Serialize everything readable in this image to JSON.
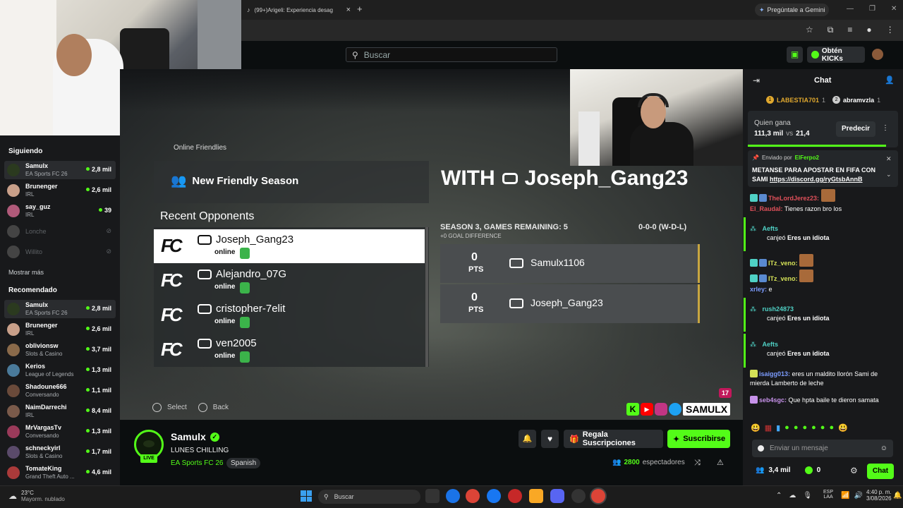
{
  "browser": {
    "tab_title": "(99+)Arigeli: Experiencia desag",
    "tab_close": "×",
    "new_tab": "+",
    "gemini": "Pregúntale a Gemini"
  },
  "header": {
    "search_placeholder": "Buscar",
    "kicks": "Obtén KICKs"
  },
  "sidebar": {
    "following_title": "Siguiendo",
    "following": [
      {
        "name": "Samulx",
        "cat": "EA Sports FC 26",
        "viewers": "2,8 mil",
        "color": "#2b3a1f"
      },
      {
        "name": "Brunenger",
        "cat": "IRL",
        "viewers": "2,6 mil",
        "color": "#c9a08a"
      },
      {
        "name": "say_guz",
        "cat": "IRL",
        "viewers": "39",
        "color": "#b05a7a"
      },
      {
        "name": "Lonche",
        "cat": "",
        "viewers": "",
        "color": "#444"
      },
      {
        "name": "Willito",
        "cat": "",
        "viewers": "",
        "color": "#444"
      }
    ],
    "show_more": "Mostrar más",
    "recommended_title": "Recomendado",
    "recommended": [
      {
        "name": "Samulx",
        "cat": "EA Sports FC 26",
        "viewers": "2,8 mil",
        "color": "#2b3a1f"
      },
      {
        "name": "Brunenger",
        "cat": "IRL",
        "viewers": "2,6 mil",
        "color": "#c9a08a"
      },
      {
        "name": "oblivionsw",
        "cat": "Slots & Casino",
        "viewers": "3,7 mil",
        "color": "#8a6a4a"
      },
      {
        "name": "Kerios",
        "cat": "League of Legends",
        "viewers": "1,3 mil",
        "color": "#4a7a9a"
      },
      {
        "name": "Shadoune666",
        "cat": "Conversando",
        "viewers": "1,1 mil",
        "color": "#6a4a3a"
      },
      {
        "name": "NaimDarrechi",
        "cat": "IRL",
        "viewers": "8,4 mil",
        "color": "#7a5a4a"
      },
      {
        "name": "MrVargasTv",
        "cat": "Conversando",
        "viewers": "1,3 mil",
        "color": "#9a3a5a"
      },
      {
        "name": "schneckyirl",
        "cat": "Slots & Casino",
        "viewers": "1,7 mil",
        "color": "#5a4a6a"
      },
      {
        "name": "TomateKing",
        "cat": "Grand Theft Auto ...",
        "viewers": "4,6 mil",
        "color": "#aa3a3a"
      }
    ]
  },
  "game": {
    "breadcrumb": "Online Friendlies",
    "new_season": "New Friendly Season",
    "recent_title": "Recent Opponents",
    "opponents": [
      {
        "name": "Joseph_Gang23",
        "status": "online"
      },
      {
        "name": "Alejandro_07G",
        "status": "online"
      },
      {
        "name": "cristopher-7elit",
        "status": "online"
      },
      {
        "name": "ven2005",
        "status": "online"
      }
    ],
    "with_title": "WITH",
    "with_name": "Joseph_Gang23",
    "season_info": "SEASON 3, GAMES REMAINING: 5",
    "goal_diff": "+0 GOAL DIFFERENCE",
    "record": "0-0-0 (W-D-L)",
    "scores": [
      {
        "pts": "0",
        "label": "PTS",
        "player": "Samulx1106"
      },
      {
        "pts": "0",
        "label": "PTS",
        "player": "Joseph_Gang23"
      }
    ],
    "select": "Select",
    "back": "Back",
    "overlay_name": "SAMULX",
    "counter": "17"
  },
  "stream": {
    "name": "Samulx",
    "title": "LUNES CHILLING",
    "category": "EA Sports FC 26",
    "language": "Spanish",
    "live": "LIVE",
    "gift": "Regala Suscripciones",
    "subscribe": "Suscribirse",
    "viewers": "2800",
    "viewers_label": "espectadores"
  },
  "chat": {
    "title": "Chat",
    "top1": "LABESTIA701",
    "top1_n": "1",
    "top2": "abramvzla",
    "top2_n": "1",
    "prediction_q": "Quien gana",
    "pred_a": "111,3 mil",
    "pred_vs": "vs",
    "pred_b": "21,4",
    "predict_btn": "Predecir",
    "pinned_by": "Enviado por",
    "pinned_user": "ElFerpo2",
    "pinned_text": "METANSE PARA APOSTAR EN FIFA CON SAMI",
    "pinned_link": "https://discord.gg/ryGtsbAnnB",
    "messages": [
      {
        "user": "TheLordJerez23:",
        "text": "",
        "color": "#e0505a"
      },
      {
        "user": "El_Raudal:",
        "text": "Tienes razon bro los",
        "color": "#e0505a"
      },
      {
        "user": "Aefts",
        "text": "canjeó",
        "bold": "Eres un idiota",
        "color": "#4fd1c5"
      },
      {
        "user": "ITz_veno:",
        "text": "",
        "color": "#d4e157"
      },
      {
        "user": "ITz_veno:",
        "text": "",
        "color": "#d4e157"
      },
      {
        "user": "xrley:",
        "text": "e",
        "color": "#7c9cff"
      },
      {
        "user": "rush24873",
        "text": "canjeó",
        "bold": "Eres un idiota",
        "color": "#4fd1c5"
      },
      {
        "user": "Aefts",
        "text": "canjeó",
        "bold": "Eres un idiota",
        "color": "#4fd1c5"
      },
      {
        "user": "isaigg013:",
        "text": "eres un maldito llorón Sami de mierda Lamberto de leche",
        "color": "#7c9cff"
      },
      {
        "user": "seb4sgc:",
        "text": "Que hpta baile te dieron samata",
        "color": "#c792ea"
      }
    ],
    "input_placeholder": "Enviar un mensaje",
    "points": "3,4 mil",
    "kicks_count": "0",
    "chat_btn": "Chat"
  },
  "taskbar": {
    "temp": "23°C",
    "weather": "Mayorm. nublado",
    "search": "Buscar",
    "lang1": "ESP",
    "lang2": "LAA",
    "time": "4:40 p. m.",
    "date": "3/08/2026"
  }
}
